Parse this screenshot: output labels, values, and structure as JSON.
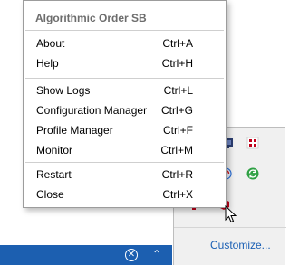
{
  "menu": {
    "title": "Algorithmic Order SB",
    "groups": [
      [
        {
          "label": "About",
          "shortcut": "Ctrl+A"
        },
        {
          "label": "Help",
          "shortcut": "Ctrl+H"
        }
      ],
      [
        {
          "label": "Show Logs",
          "shortcut": "Ctrl+L"
        },
        {
          "label": "Configuration Manager",
          "shortcut": "Ctrl+G"
        },
        {
          "label": "Profile Manager",
          "shortcut": "Ctrl+F"
        },
        {
          "label": "Monitor",
          "shortcut": "Ctrl+M"
        }
      ],
      [
        {
          "label": "Restart",
          "shortcut": "Ctrl+R"
        },
        {
          "label": "Close",
          "shortcut": "Ctrl+X"
        }
      ]
    ]
  },
  "tray": {
    "customize_label": "Customize...",
    "icons": [
      "network-icon",
      "app-grid-icon",
      "wifi-icon",
      "sync-icon",
      "app-icon"
    ]
  },
  "taskbar": {
    "icons": [
      "close-circle-icon",
      "chevron-up-icon"
    ]
  },
  "colors": {
    "taskbar": "#1c5fb0",
    "link": "#1a5fb4",
    "menu_header": "#6d6d6d",
    "app_red": "#c0001a",
    "sync_green": "#2ea043"
  }
}
